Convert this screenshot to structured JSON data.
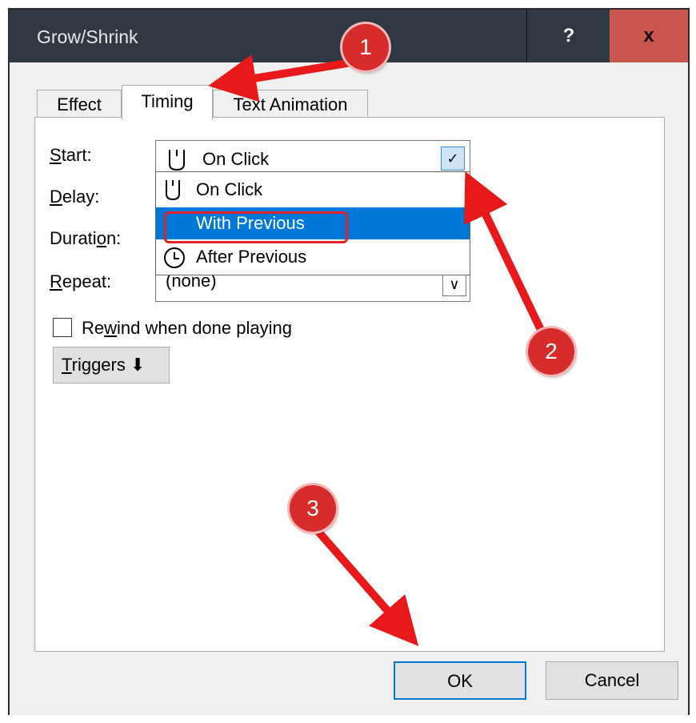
{
  "window": {
    "title": "Grow/Shrink",
    "help_label": "?",
    "close_label": "x"
  },
  "tabs": [
    {
      "label": "Effect"
    },
    {
      "label": "Timing",
      "active": true
    },
    {
      "label": "Text Animation"
    }
  ],
  "timing": {
    "start_label": {
      "pre": "",
      "u": "S",
      "post": "tart:"
    },
    "delay_label": {
      "pre": "",
      "u": "D",
      "post": "elay:"
    },
    "duration_label": {
      "pre": "Durati",
      "u": "o",
      "post": "n:"
    },
    "repeat_label": {
      "pre": "",
      "u": "R",
      "post": "epeat:"
    },
    "start_value": "On Click",
    "repeat_value": "(none)",
    "start_options": [
      "On Click",
      "With Previous",
      "After Previous"
    ],
    "selected_option": "With Previous",
    "rewind_label": {
      "pre": "Re",
      "u": "w",
      "post": "ind when done playing"
    },
    "rewind_checked": false,
    "triggers_label": {
      "pre": "",
      "u": "T",
      "post": "riggers"
    }
  },
  "buttons": {
    "ok": "OK",
    "cancel": "Cancel"
  },
  "annotations": [
    "1",
    "2",
    "3"
  ],
  "accent_color": "#0078d7",
  "annotation_color": "#d72c2c"
}
